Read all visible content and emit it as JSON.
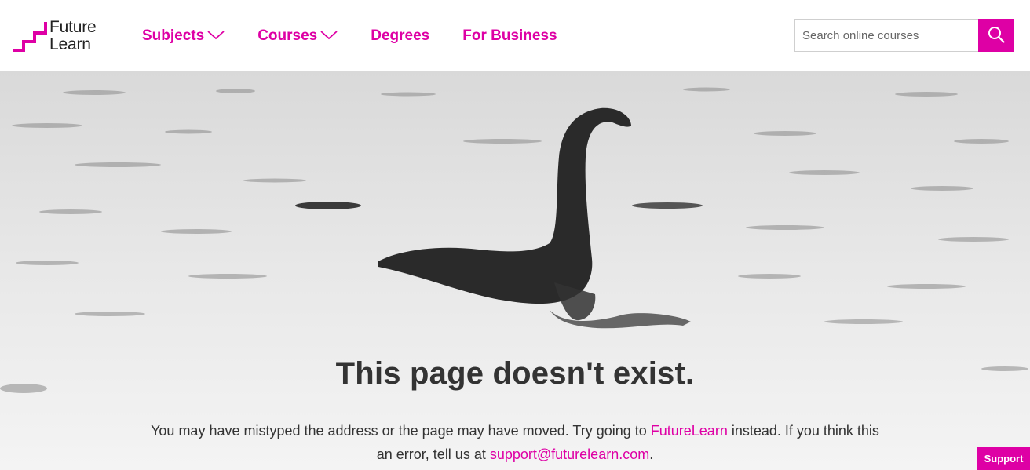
{
  "brand": {
    "name_line1": "Future",
    "name_line2": "Learn",
    "accent_color": "#de00a5"
  },
  "nav": {
    "items": [
      {
        "label": "Subjects",
        "has_dropdown": true
      },
      {
        "label": "Courses",
        "has_dropdown": true
      },
      {
        "label": "Degrees",
        "has_dropdown": false
      },
      {
        "label": "For Business",
        "has_dropdown": false
      }
    ]
  },
  "search": {
    "placeholder": "Search online courses",
    "value": "",
    "icon": "search-icon"
  },
  "error": {
    "title": "This page doesn't exist.",
    "message_part1": "You may have mistyped the address or the page may have moved. Try going to ",
    "home_link": "FutureLearn",
    "message_part2": " instead. If you think this an error, tell us at ",
    "support_email": "support@futurelearn.com",
    "message_end": "."
  },
  "support": {
    "label": "Support"
  }
}
